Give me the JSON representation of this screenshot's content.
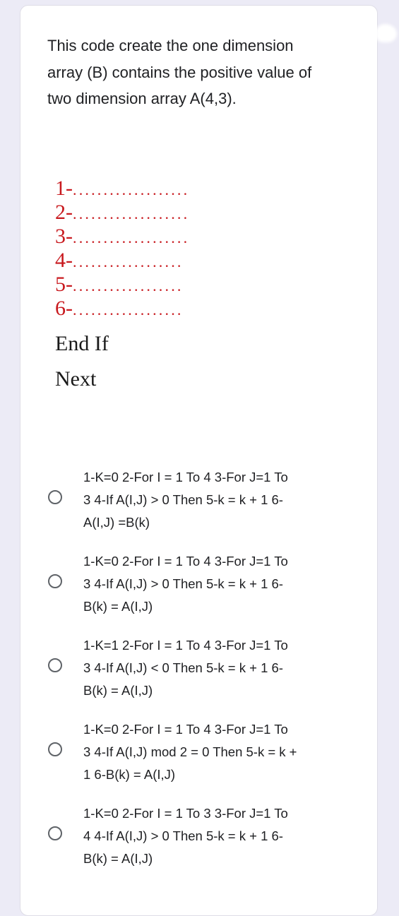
{
  "question": {
    "text": "This code create the one dimension array (B) contains the positive value of two dimension array A(4,3)."
  },
  "code_image": {
    "lines": [
      {
        "number": "1-",
        "dots": "..................."
      },
      {
        "number": "2-",
        "dots": "..................."
      },
      {
        "number": "3-",
        "dots": "..................."
      },
      {
        "number": "4-",
        "dots": ".................."
      },
      {
        "number": "5-",
        "dots": ".................."
      },
      {
        "number": "6-",
        "dots": ".................."
      }
    ],
    "end_if": "End If",
    "next": "Next",
    "number_color": "#c8191e"
  },
  "options": [
    {
      "label": "1-K=0 2-For I = 1 To 4 3-For J=1 To\n3 4-If A(I,J) > 0 Then 5-k = k + 1 6-\nA(I,J) =B(k)",
      "selected": false
    },
    {
      "label": "1-K=0 2-For I = 1 To 4 3-For J=1 To\n3 4-If A(I,J) > 0 Then 5-k = k + 1 6-\nB(k) = A(I,J)",
      "selected": false
    },
    {
      "label": "1-K=1 2-For I = 1 To 4 3-For J=1 To\n3 4-If A(I,J) < 0 Then 5-k = k + 1 6-\nB(k) = A(I,J)",
      "selected": false
    },
    {
      "label": "1-K=0 2-For I = 1 To 4 3-For J=1 To\n3 4-If A(I,J) mod 2 = 0 Then 5-k = k +\n1 6-B(k) = A(I,J)",
      "selected": false
    },
    {
      "label": "1-K=0 2-For I = 1 To 3 3-For J=1 To\n4 4-If A(I,J) > 0 Then 5-k = k + 1 6-\nB(k) = A(I,J)",
      "selected": false
    }
  ],
  "icons": {
    "radio": "radio-unchecked-icon"
  }
}
